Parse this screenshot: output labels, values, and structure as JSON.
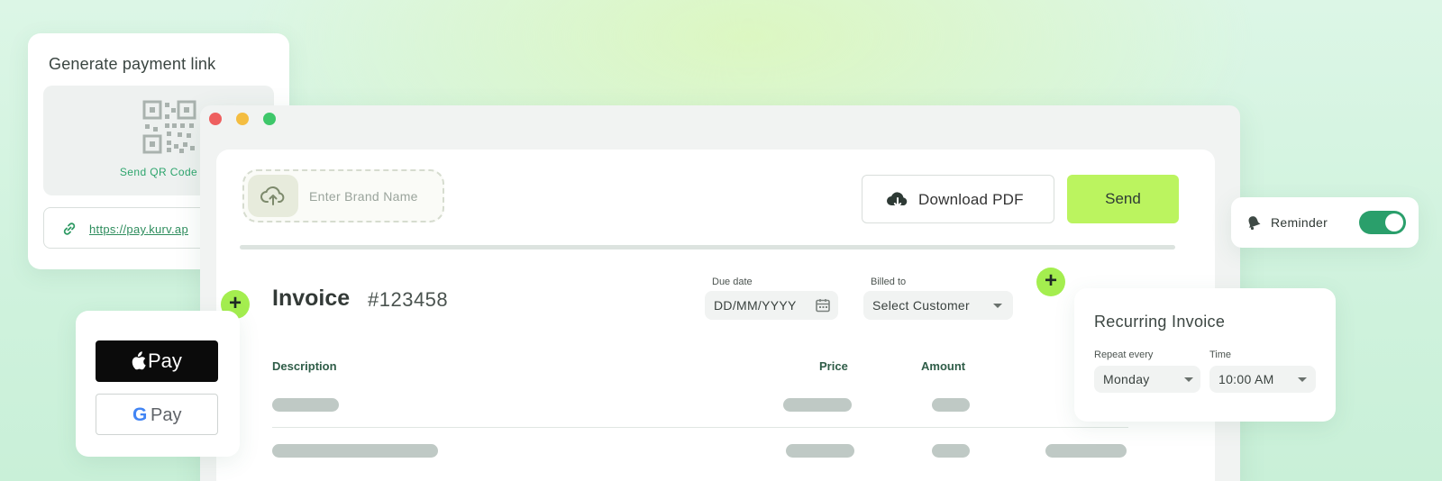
{
  "payment_link": {
    "title": "Generate payment link",
    "qr_label": "Send QR Code",
    "url": "https://pay.kurv.ap",
    "icons": {
      "qr": "qr-code-icon",
      "link": "link-icon"
    }
  },
  "window_controls": [
    "close",
    "minimize",
    "maximize"
  ],
  "toolbar": {
    "brand_placeholder": "Enter Brand Name",
    "download_label": "Download PDF",
    "send_label": "Send",
    "icons": {
      "upload": "cloud-upload-icon",
      "download": "cloud-download-icon"
    }
  },
  "invoice": {
    "title": "Invoice",
    "number": "#123458",
    "due_date": {
      "label": "Due date",
      "value": "DD/MM/YYYY"
    },
    "billed_to": {
      "label": "Billed to",
      "value": "Select Customer"
    },
    "columns": [
      "Description",
      "Price",
      "Amount"
    ]
  },
  "pay_methods": {
    "apple": "Pay",
    "google_g": "G",
    "google": "Pay"
  },
  "reminder": {
    "label": "Reminder",
    "enabled": true
  },
  "recurring": {
    "title": "Recurring Invoice",
    "repeat_label": "Repeat every",
    "repeat_value": "Monday",
    "time_label": "Time",
    "time_value": "10:00 AM"
  },
  "colors": {
    "accent": "#bbf45f",
    "plus": "#a4ee4f",
    "toggle": "#2a9f6b",
    "link": "#2ea56d"
  }
}
